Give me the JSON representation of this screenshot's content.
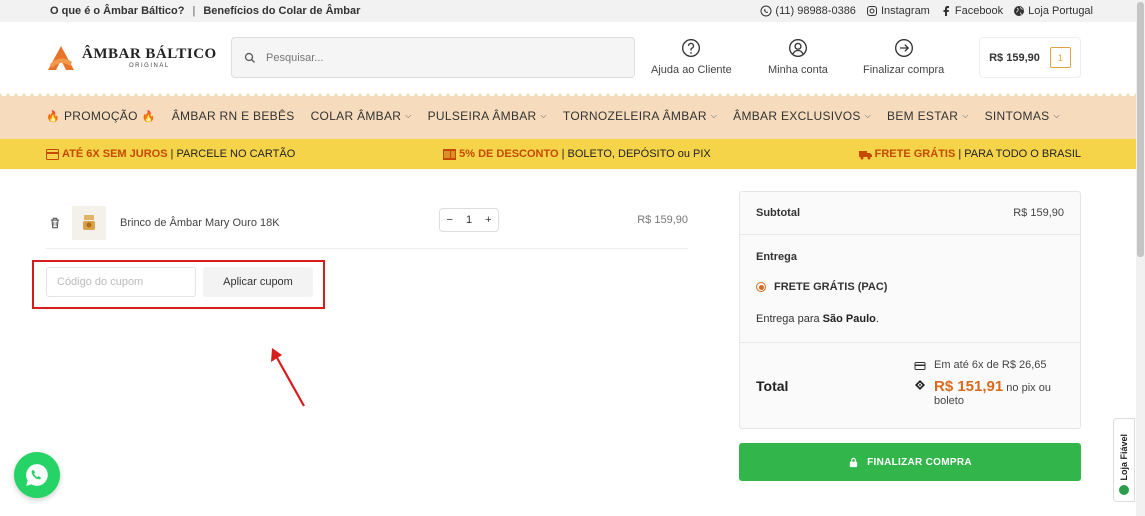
{
  "topbar": {
    "links": [
      "O que é o Âmbar Báltico?",
      "Benefícios do Colar de Âmbar"
    ],
    "separator": "|",
    "phone": "(11) 98988-0386",
    "instagram": "Instagram",
    "facebook": "Facebook",
    "portugal": "Loja Portugal"
  },
  "header": {
    "brand": "ÂMBAR BÁLTICO",
    "brand_sub": "ORIGINAL",
    "search_placeholder": "Pesquisar...",
    "help": "Ajuda ao Cliente",
    "account": "Minha conta",
    "checkout": "Finalizar compra",
    "cart_total": "R$ 159,90",
    "cart_count": "1"
  },
  "nav": {
    "items": [
      "PROMOÇÃO",
      "ÂMBAR RN E BEBÊS",
      "COLAR ÂMBAR",
      "PULSEIRA ÂMBAR",
      "TORNOZELEIRA ÂMBAR",
      "ÂMBAR EXCLUSIVOS",
      "BEM ESTAR",
      "SINTOMAS"
    ]
  },
  "promo": {
    "s1_hl": "ATÉ 6X SEM JUROS",
    "s1_rest": "| PARCELE NO CARTÃO",
    "s2_hl": "5% DE DESCONTO",
    "s2_rest": "| BOLETO, DEPÓSITO ou PIX",
    "s3_hl": "FRETE GRÁTIS",
    "s3_rest": "| PARA TODO O BRASIL"
  },
  "cart_item": {
    "name": "Brinco de Âmbar Mary Ouro 18K",
    "qty": "1",
    "minus": "−",
    "plus": "+",
    "price": "R$ 159,90"
  },
  "coupon": {
    "placeholder": "Código do cupom",
    "button": "Aplicar cupom"
  },
  "summary": {
    "subtotal_label": "Subtotal",
    "subtotal_value": "R$ 159,90",
    "shipping_label": "Entrega",
    "shipping_option": "FRETE GRÁTIS (PAC)",
    "destination_prefix": "Entrega para",
    "destination_city": "São Paulo",
    "total_label": "Total",
    "installments": "Em até 6x de R$ 26,65",
    "pix_value": "R$ 151,91",
    "pix_text": "no pix ou boleto",
    "finalize": "FINALIZAR COMPRA"
  },
  "seal": {
    "text": "Loja Fiável"
  },
  "colors": {
    "accent": "#d96a1d",
    "nav_bg": "#f6dcbd",
    "promo_bg": "#f5d44a",
    "finalize_bg": "#32b54a",
    "highlight": "#d71c1c"
  }
}
